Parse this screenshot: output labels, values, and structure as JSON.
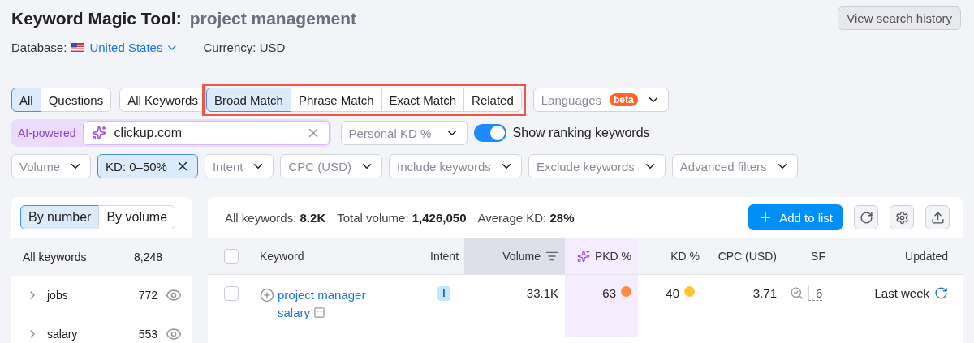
{
  "header": {
    "title": "Keyword Magic Tool:",
    "query": "project management",
    "history_button": "View search history",
    "database_label": "Database:",
    "database_value": "United States",
    "currency": "Currency: USD"
  },
  "type_tabs": [
    {
      "label": "All",
      "selected": true
    },
    {
      "label": "Questions",
      "selected": false
    }
  ],
  "all_keywords_button": "All Keywords",
  "match_tabs": {
    "highlighted": true,
    "items": [
      {
        "label": "Broad Match",
        "selected": true
      },
      {
        "label": "Phrase Match",
        "selected": false
      },
      {
        "label": "Exact Match",
        "selected": false
      },
      {
        "label": "Related",
        "selected": false
      }
    ]
  },
  "languages": {
    "label": "Languages",
    "badge": "beta"
  },
  "ai_search": {
    "badge": "AI-powered",
    "value": "clickup.com"
  },
  "personal_kd": {
    "placeholder": "Personal KD %"
  },
  "ranking_toggle": {
    "label": "Show ranking keywords",
    "on": true
  },
  "filters": [
    {
      "label": "Volume",
      "active": false
    },
    {
      "label": "KD: 0–50%",
      "active": true
    },
    {
      "label": "Intent",
      "active": false
    },
    {
      "label": "CPC (USD)",
      "active": false
    },
    {
      "label": "Include keywords",
      "active": false
    },
    {
      "label": "Exclude keywords",
      "active": false
    },
    {
      "label": "Advanced filters",
      "active": false
    }
  ],
  "groups": {
    "tabs": [
      {
        "label": "By number",
        "selected": true
      },
      {
        "label": "By volume",
        "selected": false
      }
    ],
    "total": {
      "label": "All keywords",
      "count": "8,248"
    },
    "items": [
      {
        "label": "jobs",
        "count": "772"
      },
      {
        "label": "salary",
        "count": "553"
      }
    ]
  },
  "summary": [
    {
      "label": "All keywords:",
      "value": "8.2K"
    },
    {
      "label": "Total volume:",
      "value": "1,426,050"
    },
    {
      "label": "Average KD:",
      "value": "28%"
    }
  ],
  "add_button": "Add to list",
  "table": {
    "columns": [
      "Keyword",
      "Intent",
      "Volume",
      "PKD %",
      "KD %",
      "CPC (USD)",
      "SF",
      "Updated"
    ],
    "select_all_checked": false,
    "rows": [
      {
        "checked": false,
        "keyword": "project manager salary",
        "intent": "I",
        "volume": "33.1K",
        "pkd": {
          "value": "63",
          "color": "#ff8c3a"
        },
        "kd": {
          "value": "40",
          "color": "#ffc533"
        },
        "cpc": "3.71",
        "sf": "6",
        "updated": "Last week"
      }
    ]
  }
}
